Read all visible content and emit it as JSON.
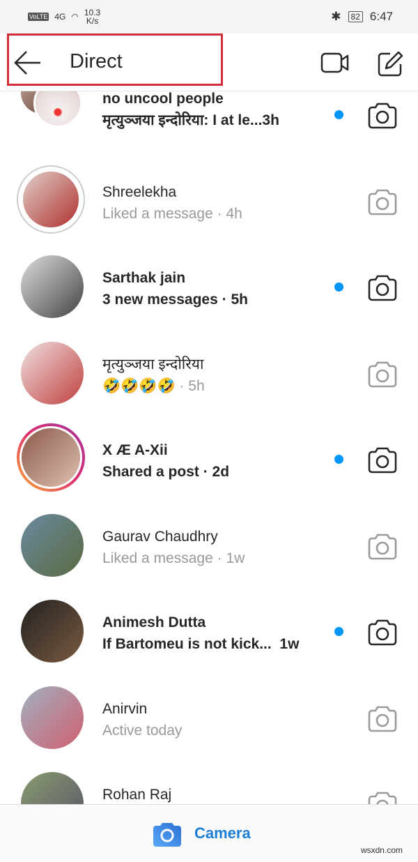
{
  "status_bar": {
    "network": "VoLTE",
    "signal": "4G",
    "speed": "10.3",
    "speed_unit": "K/s",
    "battery": "82",
    "time": "6:47"
  },
  "header": {
    "title": "Direct"
  },
  "colors": {
    "accent": "#0095f6",
    "highlight": "#d32f3a",
    "camera_label": "#1a7fd4"
  },
  "threads": [
    {
      "name": "no uncool people",
      "preview": "मृत्युञ्जया इन्दोरिया: I at le...",
      "time": "3h",
      "sep": "",
      "unread": true,
      "avatar": "group"
    },
    {
      "name": "Shreelekha",
      "preview": "Liked a message",
      "time": "4h",
      "sep": " · ",
      "unread": false,
      "avatar": "gray-ring"
    },
    {
      "name": "Sarthak jain",
      "preview": "3 new messages",
      "time": "5h",
      "sep": " · ",
      "unread": true,
      "avatar": "plain"
    },
    {
      "name": "मृत्युञ्जया इन्दोरिया",
      "preview": "🤣🤣🤣🤣",
      "time": "5h",
      "sep": " · ",
      "unread": false,
      "avatar": "plain"
    },
    {
      "name": "X Æ A-Xii",
      "preview": "Shared a post",
      "time": "2d",
      "sep": " · ",
      "unread": true,
      "avatar": "story-ring"
    },
    {
      "name": "Gaurav Chaudhry",
      "preview": "Liked a message",
      "time": "1w",
      "sep": " · ",
      "unread": false,
      "avatar": "plain"
    },
    {
      "name": "Animesh Dutta",
      "preview": "If Bartomeu is not kick...",
      "time": "1w",
      "sep": "  ",
      "unread": true,
      "avatar": "plain"
    },
    {
      "name": "Anirvin",
      "preview": "Active today",
      "time": "",
      "sep": "",
      "unread": false,
      "avatar": "plain"
    },
    {
      "name": "Rohan Raj",
      "preview": "",
      "time": "",
      "sep": "",
      "unread": false,
      "avatar": "plain"
    }
  ],
  "bottom_bar": {
    "camera_label": "Camera"
  },
  "watermark": "wsxdn.com"
}
